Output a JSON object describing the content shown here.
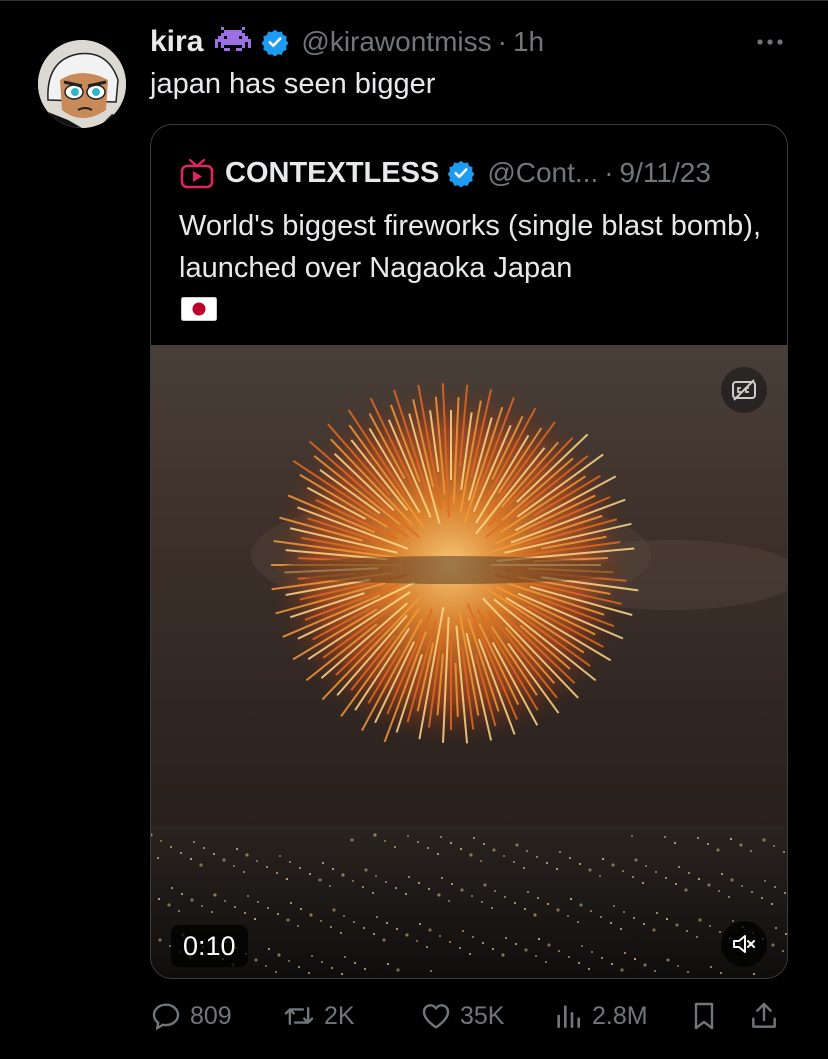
{
  "post": {
    "author_name": "kira",
    "author_handle": "@kirawontmiss",
    "separator": "·",
    "time": "1h",
    "text": "japan has seen bigger",
    "author_emoji": "alien-monster-icon",
    "verified_color": "#1d9bf0"
  },
  "quote": {
    "author_name": "CONTEXTLESS",
    "author_handle": "@Cont...",
    "separator": "·",
    "date": "9/11/23",
    "text": "World's biggest fireworks (single blast bomb), launched over Nagaoka Japan",
    "flag": "japan-flag-icon",
    "video": {
      "duration": "0:10",
      "captions_icon": "captions-off-icon",
      "mute_icon": "muted-speaker-icon"
    }
  },
  "actions": {
    "replies": "809",
    "reposts": "2K",
    "likes": "35K",
    "views": "2.8M"
  },
  "colors": {
    "background": "#000000",
    "text_primary": "#e7e9ea",
    "text_secondary": "#71767b",
    "border": "#2f3336"
  }
}
